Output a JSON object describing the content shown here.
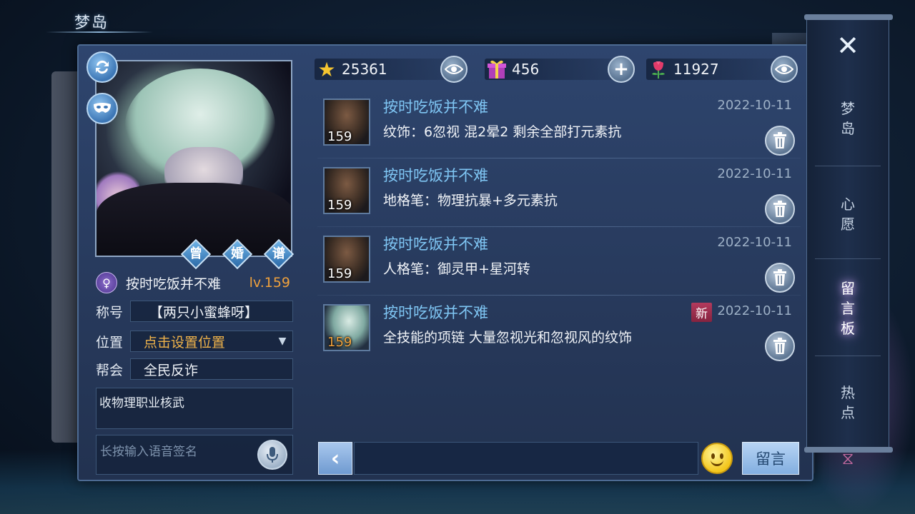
{
  "window": {
    "title": "梦岛"
  },
  "profile": {
    "badges": [
      "曾",
      "婚",
      "谱"
    ],
    "gender_symbol": "♀",
    "name": "按时吃饭并不难",
    "level": "lv.159",
    "title_label": "称号",
    "title_value": "【两只小蜜蜂呀】",
    "location_label": "位置",
    "location_value": "点击设置位置",
    "guild_label": "帮会",
    "guild_value": "全民反诈",
    "bio": "收物理职业核武",
    "voice_placeholder": "长按输入语音签名"
  },
  "currency": {
    "stars": "25361",
    "gifts": "456",
    "flowers": "11927"
  },
  "messages": [
    {
      "author": "按时吃饭并不难",
      "date": "2022-10-11",
      "text": "纹饰：6忽视 混2晕2 剩余全部打元素抗",
      "level": "159",
      "is_new": false
    },
    {
      "author": "按时吃饭并不难",
      "date": "2022-10-11",
      "text": "地格笔：物理抗暴+多元素抗",
      "level": "159",
      "is_new": false
    },
    {
      "author": "按时吃饭并不难",
      "date": "2022-10-11",
      "text": "人格笔：御灵甲+星河转",
      "level": "159",
      "is_new": false
    },
    {
      "author": "按时吃饭并不难",
      "date": "2022-10-11",
      "text": "全技能的项链 大量忽视光和忽视风的纹饰",
      "level": "159",
      "is_new": true,
      "new_label": "新"
    }
  ],
  "input": {
    "value": "",
    "post_label": "留言"
  },
  "side_tabs": [
    {
      "label": "梦\n岛",
      "active": false
    },
    {
      "label": "心\n愿",
      "active": false
    },
    {
      "label": "留\n言\n板",
      "active": true
    },
    {
      "label": "热\n点",
      "active": false
    }
  ],
  "colors": {
    "author": "#7fc6f4",
    "level": "#f0a13c",
    "new_badge": "#b33a5d",
    "panel": "#2e456e"
  }
}
